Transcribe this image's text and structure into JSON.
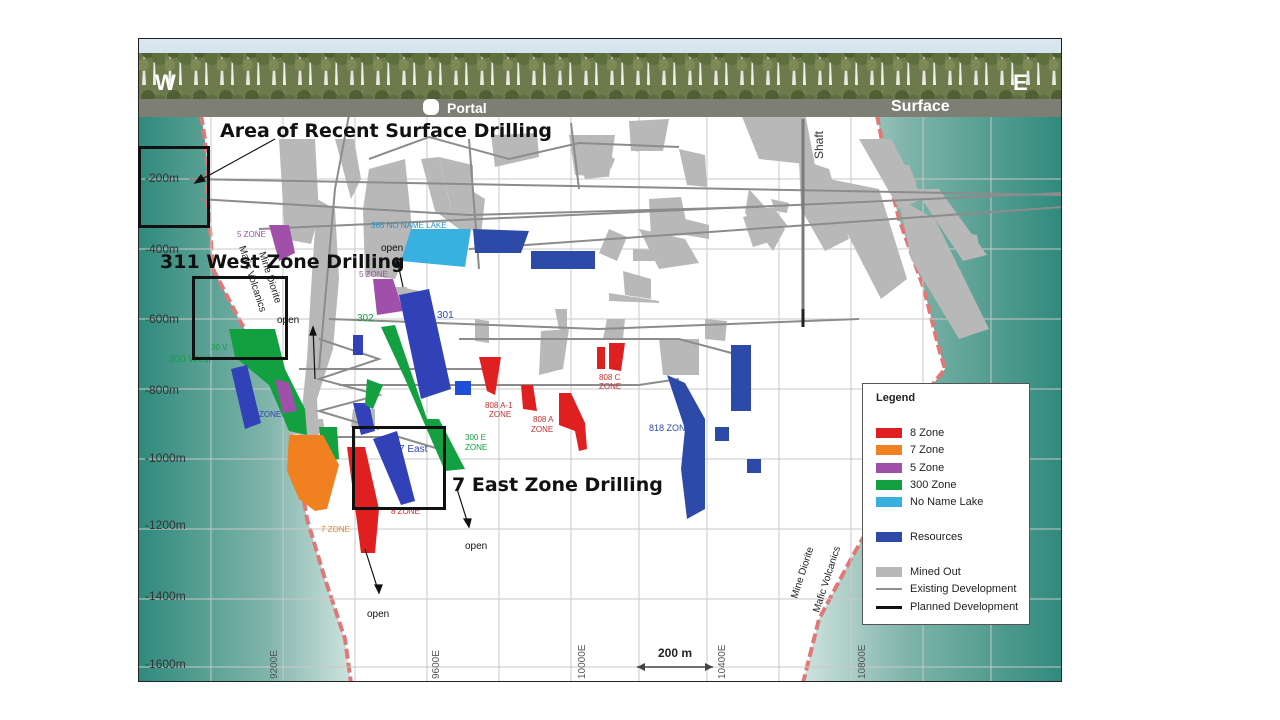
{
  "compass": {
    "west": "W",
    "east": "E"
  },
  "surface": {
    "portal": "Portal",
    "surface": "Surface",
    "shaft": "Shaft"
  },
  "depth_labels": [
    "-200m",
    "-400m",
    "-600m",
    "-800m",
    "-1000m",
    "-1200m",
    "-1400m",
    "-1600m"
  ],
  "easting_labels": [
    "9200E",
    "9600E",
    "10000E",
    "10400E",
    "10800E"
  ],
  "scale_bar": "200 m",
  "zone_labels": {
    "five_zone_top": "5 ZONE",
    "five_zone_mid": "5 ZONE",
    "no_name_lake": "365 NO NAME LAKE",
    "z301": "301",
    "z302": "302",
    "west_300": "300 West",
    "west_30v": "30 V",
    "z300e_a": "300 E",
    "z300e_b": "ZONE",
    "seven_east": "7 East",
    "seven_zone": "7 ZONE",
    "eight_zone": "8 ZONE",
    "z808a1_a": "808 A-1",
    "z808a1_b": "ZONE",
    "z808a_a": "808 A",
    "z808a_b": "ZONE",
    "z808c_a": "808 C",
    "z808c_b": "ZONE",
    "z818": "818 ZONE",
    "left_zone": "ZONE"
  },
  "open_labels": {
    "o1": "open",
    "o2": "open",
    "o3": "open",
    "o4": "open"
  },
  "geology": {
    "mine_diorite_left": "Mine Diorite",
    "mafic_volcanics_left": "Mafic Volcanics",
    "mine_diorite_right": "Mine Diorite",
    "mafic_volcanics_right": "Mafic Volcanics"
  },
  "callouts": {
    "surface_drilling": "Area of Recent Surface Drilling",
    "west_zone_drilling": "311 West Zone Drilling",
    "east_zone_drilling": "7 East Zone Drilling"
  },
  "legend": {
    "title": "Legend",
    "zones": [
      {
        "label": "8 Zone",
        "color": "#e02020"
      },
      {
        "label": "7 Zone",
        "color": "#f08020"
      },
      {
        "label": "5 Zone",
        "color": "#a050a8"
      },
      {
        "label": "300 Zone",
        "color": "#12a040"
      },
      {
        "label": "No Name Lake",
        "color": "#38b0e0"
      }
    ],
    "resources": {
      "label": "Resources",
      "color": "#2e4aa8"
    },
    "mined_out": {
      "label": "Mined Out",
      "color": "#b8b8b8"
    },
    "existing_development": {
      "label": "Existing Development",
      "color": "#909090"
    },
    "planned_development": {
      "label": "Planned Development",
      "color": "#111111"
    }
  },
  "colors": {
    "mafic": "#3f8f82",
    "contact": "#e07878",
    "grid": "#c8c8c8",
    "sky": "#cfe0ec",
    "trees": "#5a6a3a"
  }
}
